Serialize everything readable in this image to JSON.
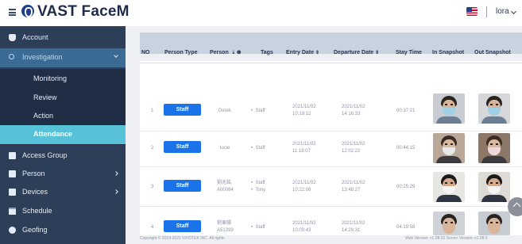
{
  "header": {
    "app_title": "VAST FaceM",
    "username": "lora",
    "language_icon": "us-flag-icon",
    "menu_icon": "hamburger-icon"
  },
  "sidebar": {
    "items": [
      {
        "label": "Account",
        "icon": "account-icon"
      },
      {
        "label": "Investigation",
        "icon": "search-icon"
      },
      {
        "label": "Monitoring"
      },
      {
        "label": "Review"
      },
      {
        "label": "Action"
      },
      {
        "label": "Attendance"
      },
      {
        "label": "Access Group",
        "icon": "group-icon"
      },
      {
        "label": "Person",
        "icon": "person-icon"
      },
      {
        "label": "Devices",
        "icon": "device-icon"
      },
      {
        "label": "Schedule",
        "icon": "calendar-icon"
      },
      {
        "label": "Geofing",
        "icon": "geofence-icon"
      }
    ]
  },
  "table": {
    "columns": [
      "NO",
      "Person Type",
      "Person",
      "Tags",
      "Entry Date",
      "Departure Date",
      "Stay Time",
      "In Snapshot",
      "Out Snapshot"
    ],
    "sort_icon": "⇕",
    "rows": [
      {
        "no": "1",
        "type": "Staff",
        "person": "Derek",
        "tags": [
          "Staff"
        ],
        "entry_date": "2021/11/02",
        "entry_time": "10:19:12",
        "departure_date": "2021/11/02",
        "departure_time": "14:16:33",
        "stay_time": "00:37:21"
      },
      {
        "no": "2",
        "type": "Staff",
        "person": "lucie",
        "tags": [
          "Staff"
        ],
        "entry_date": "2021/11/02",
        "entry_time": "11:18:07",
        "departure_date": "2021/11/02",
        "departure_time": "12:02:22",
        "stay_time": "00:44:15"
      },
      {
        "no": "3",
        "type": "Staff",
        "person": "劉兆銘",
        "person_id": "A00084",
        "tags": [
          "Staff",
          "Tony"
        ],
        "entry_date": "2021/11/02",
        "entry_time": "10:22:08",
        "departure_date": "2021/11/02",
        "departure_time": "13:48:27",
        "stay_time": "00:25:29"
      },
      {
        "no": "4",
        "type": "Staff",
        "person": "劉東陽",
        "person_id": "A51399",
        "tags": [
          "Staff"
        ],
        "entry_date": "2021/11/02",
        "entry_time": "10:09:43",
        "departure_date": "2021/11/02",
        "departure_time": "14:29:31",
        "stay_time": "04:19:58"
      }
    ]
  },
  "footer": {
    "copyright": "Copyright © 2019-2021 VIVOTEK INC. All rights",
    "versions": "Web Version: v1.08.02   Server Version: v1.08.0"
  },
  "colors": {
    "sidebar_bg": "#2c3e58",
    "active_sub": "#56c1d8",
    "staff_button": "#1a73e8"
  }
}
